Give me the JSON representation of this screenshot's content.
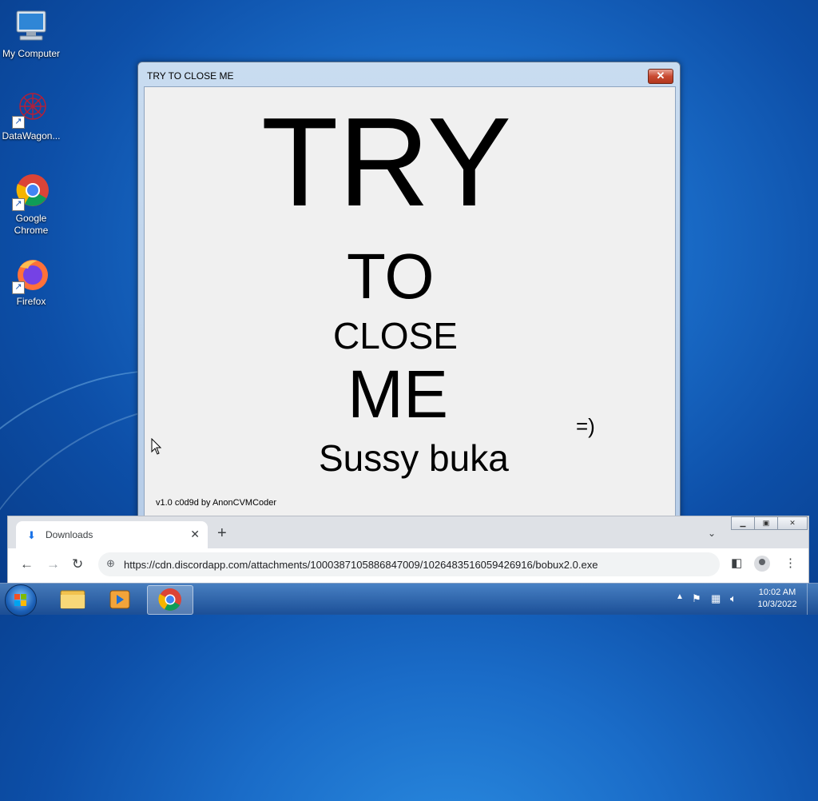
{
  "desktop": {
    "icons": [
      {
        "label": "My Computer"
      },
      {
        "label": "DataWagon..."
      },
      {
        "label": "Google Chrome"
      },
      {
        "label": "Firefox"
      }
    ]
  },
  "dialog": {
    "title": "TRY TO CLOSE ME",
    "close_glyph": "✕",
    "lines": {
      "try": "TRY",
      "to": "TO",
      "close": "CLOSE",
      "me": "ME",
      "smile": "=)",
      "sussy": "Sussy buka"
    },
    "version": "v1.0 c0d9d by AnonCVMCoder"
  },
  "browser": {
    "tab_label": "Downloads",
    "tab_close": "✕",
    "new_tab": "+",
    "url": "https://cdn.discordapp.com/attachments/1000387105886847009/1026483516059426916/bobux2.0.exe",
    "back": "←",
    "forward": "→",
    "reload": "↻",
    "menu": "⋮"
  },
  "taskbar": {
    "clock_time": "10:02 AM",
    "clock_date": "10/3/2022"
  },
  "colors": {
    "desktop_bg": "#1a6cc8",
    "close_button": "#c94a31",
    "dialog_bg": "#f0f0f0",
    "chrome_accent": "#1a73e8"
  }
}
